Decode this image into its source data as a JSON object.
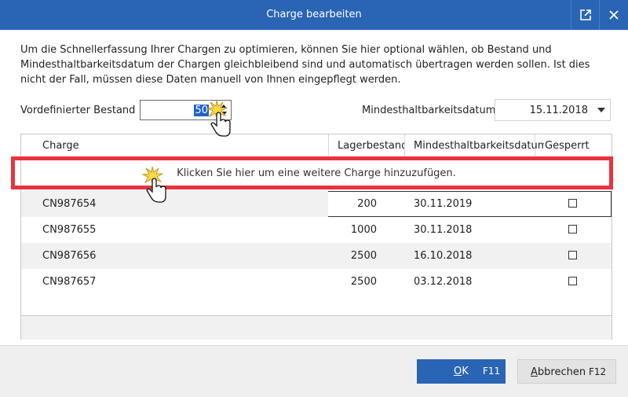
{
  "window": {
    "title": "Charge bearbeiten",
    "colors": {
      "titlebar": "#2a64b4",
      "highlight": "#e8333e",
      "primary_button": "#2a64b4"
    }
  },
  "description": "Um die Schnellerfassung Ihrer Chargen zu optimieren, können Sie hier optional wählen, ob Bestand und Mindesthaltbarkeitsdatum der Chargen gleichbleibend sind und automatisch übertragen werden sollen. Ist dies nicht der Fall, müssen diese Daten manuell von Ihnen eingepflegt werden.",
  "fields": {
    "bestand_label": "Vordefinierter Bestand",
    "bestand_value": "50",
    "mhd_label": "Mindesthaltbarkeitsdatum",
    "mhd_value": "15.11.2018"
  },
  "table": {
    "columns": [
      "Charge",
      "Lagerbestand",
      "Mindesthaltbarkeitsdatum",
      "Gesperrt"
    ],
    "add_row_text": "Klicken Sie hier um eine weitere Charge hinzuzufügen.",
    "rows": [
      {
        "charge": "CN987654",
        "bestand": "200",
        "mhd": "30.11.2019",
        "gesperrt": false
      },
      {
        "charge": "CN987655",
        "bestand": "1000",
        "mhd": "30.11.2018",
        "gesperrt": false
      },
      {
        "charge": "CN987656",
        "bestand": "2500",
        "mhd": "16.10.2018",
        "gesperrt": false
      },
      {
        "charge": "CN987657",
        "bestand": "2500",
        "mhd": "03.12.2018",
        "gesperrt": false
      }
    ]
  },
  "buttons": {
    "ok_underlined": "O",
    "ok_rest": "K",
    "ok_shortcut": "F11",
    "cancel_underlined": "A",
    "cancel_rest": "bbrechen",
    "cancel_shortcut": "F12"
  },
  "icons": [
    "external-link-icon",
    "close-icon",
    "spin-up-icon",
    "spin-down-icon",
    "dropdown-caret-icon",
    "hand-cursor-icon",
    "click-burst-icon"
  ]
}
